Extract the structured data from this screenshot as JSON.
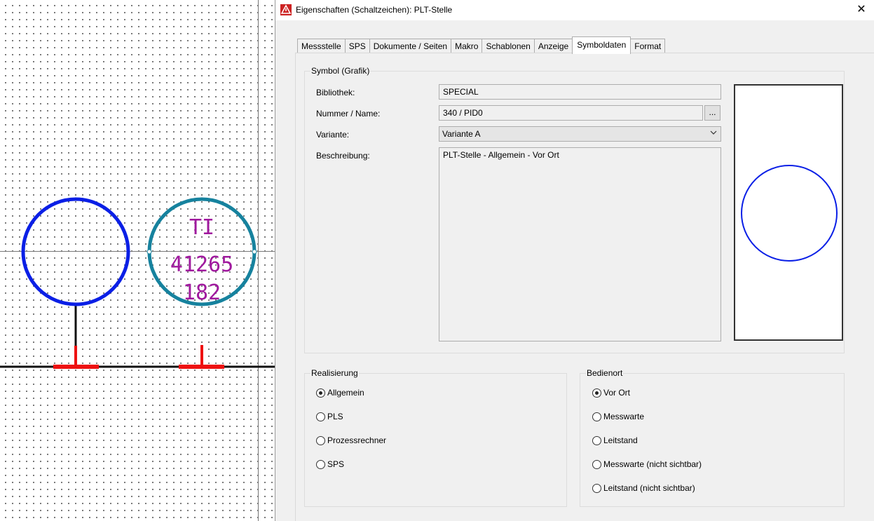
{
  "canvas": {
    "symbol_label_top": "TI",
    "symbol_label_num1": "41265",
    "symbol_label_num2": "182"
  },
  "dialog": {
    "title": "Eigenschaften (Schaltzeichen): PLT-Stelle",
    "close_glyph": "✕",
    "tabs": [
      "Messstelle",
      "SPS",
      "Dokumente / Seiten",
      "Makro",
      "Schablonen",
      "Anzeige",
      "Symboldaten",
      "Format"
    ],
    "active_tab": "Symboldaten"
  },
  "symbol": {
    "group_title": "Symbol (Grafik)",
    "bibliothek_label": "Bibliothek:",
    "bibliothek_value": "SPECIAL",
    "nummer_label": "Nummer / Name:",
    "nummer_value": "340 / PID0",
    "browse_label": "...",
    "variante_label": "Variante:",
    "variante_value": "Variante A",
    "beschreibung_label": "Beschreibung:",
    "beschreibung_value": "PLT-Stelle - Allgemein - Vor Ort"
  },
  "realisierung": {
    "group_title": "Realisierung",
    "options": [
      {
        "label": "Allgemein",
        "checked": true
      },
      {
        "label": "PLS",
        "checked": false
      },
      {
        "label": "Prozessrechner",
        "checked": false
      },
      {
        "label": "SPS",
        "checked": false
      }
    ]
  },
  "bedienort": {
    "group_title": "Bedienort",
    "options": [
      {
        "label": "Vor Ort",
        "checked": true
      },
      {
        "label": "Messwarte",
        "checked": false
      },
      {
        "label": "Leitstand",
        "checked": false
      },
      {
        "label": "Messwarte (nicht sichtbar)",
        "checked": false
      },
      {
        "label": "Leitstand (nicht sichtbar)",
        "checked": false
      }
    ]
  },
  "colors": {
    "circle_blue": "#0a1fe6",
    "circle_teal": "#16829e",
    "text_magenta": "#a0199e",
    "marker_red": "#ee1111",
    "app_icon_red": "#cc2222"
  }
}
